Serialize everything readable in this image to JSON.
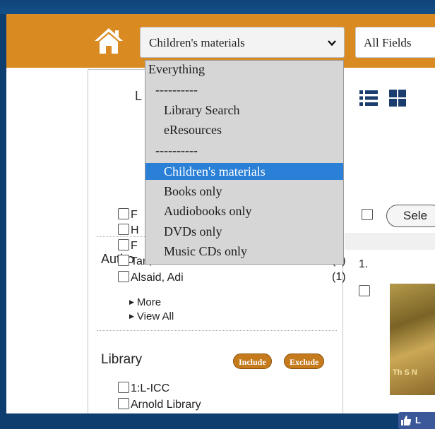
{
  "header": {
    "search_scope_value": "Children's materials",
    "search_field_value": "All Fields"
  },
  "dropdown": {
    "options": [
      {
        "label": "Everything",
        "indent": 0
      },
      {
        "label": "----------",
        "indent": 1
      },
      {
        "label": "Library Search",
        "indent": 2
      },
      {
        "label": "eResources",
        "indent": 2
      },
      {
        "label": "----------",
        "indent": 1
      },
      {
        "label": "Children's materials",
        "indent": 2
      },
      {
        "label": "Books only",
        "indent": 2
      },
      {
        "label": "Audiobooks only",
        "indent": 2
      },
      {
        "label": "DVDs only",
        "indent": 2
      },
      {
        "label": "Music CDs only",
        "indent": 2
      }
    ],
    "selected": "Children's materials"
  },
  "sidebar": {
    "limit_heading_partial": "L",
    "author": {
      "heading_partial": "Autho",
      "items": [
        {
          "label": "F",
          "count": ""
        },
        {
          "label": "H",
          "count": ""
        },
        {
          "label": "F",
          "count": ""
        },
        {
          "label": "Tan, Shaun.",
          "count": "(2)"
        },
        {
          "label": "Alsaid, Adi",
          "count": "(1)"
        }
      ],
      "more_label": "More",
      "view_all_label": "View All"
    },
    "library": {
      "heading": "Library",
      "include_label": "Include",
      "exclude_label": "Exclude",
      "items": [
        "1:L-ICC",
        "Arnold Library"
      ]
    }
  },
  "results": {
    "select_label_partial": "Sele",
    "first_result_number": "1.",
    "cover_text": "Th S N",
    "like_label_partial": "L"
  },
  "colors": {
    "header_orange": "#d98b22",
    "selected_option": "#2a7fd7",
    "pill": "#c57a1c",
    "like_blue": "#3b5998"
  }
}
